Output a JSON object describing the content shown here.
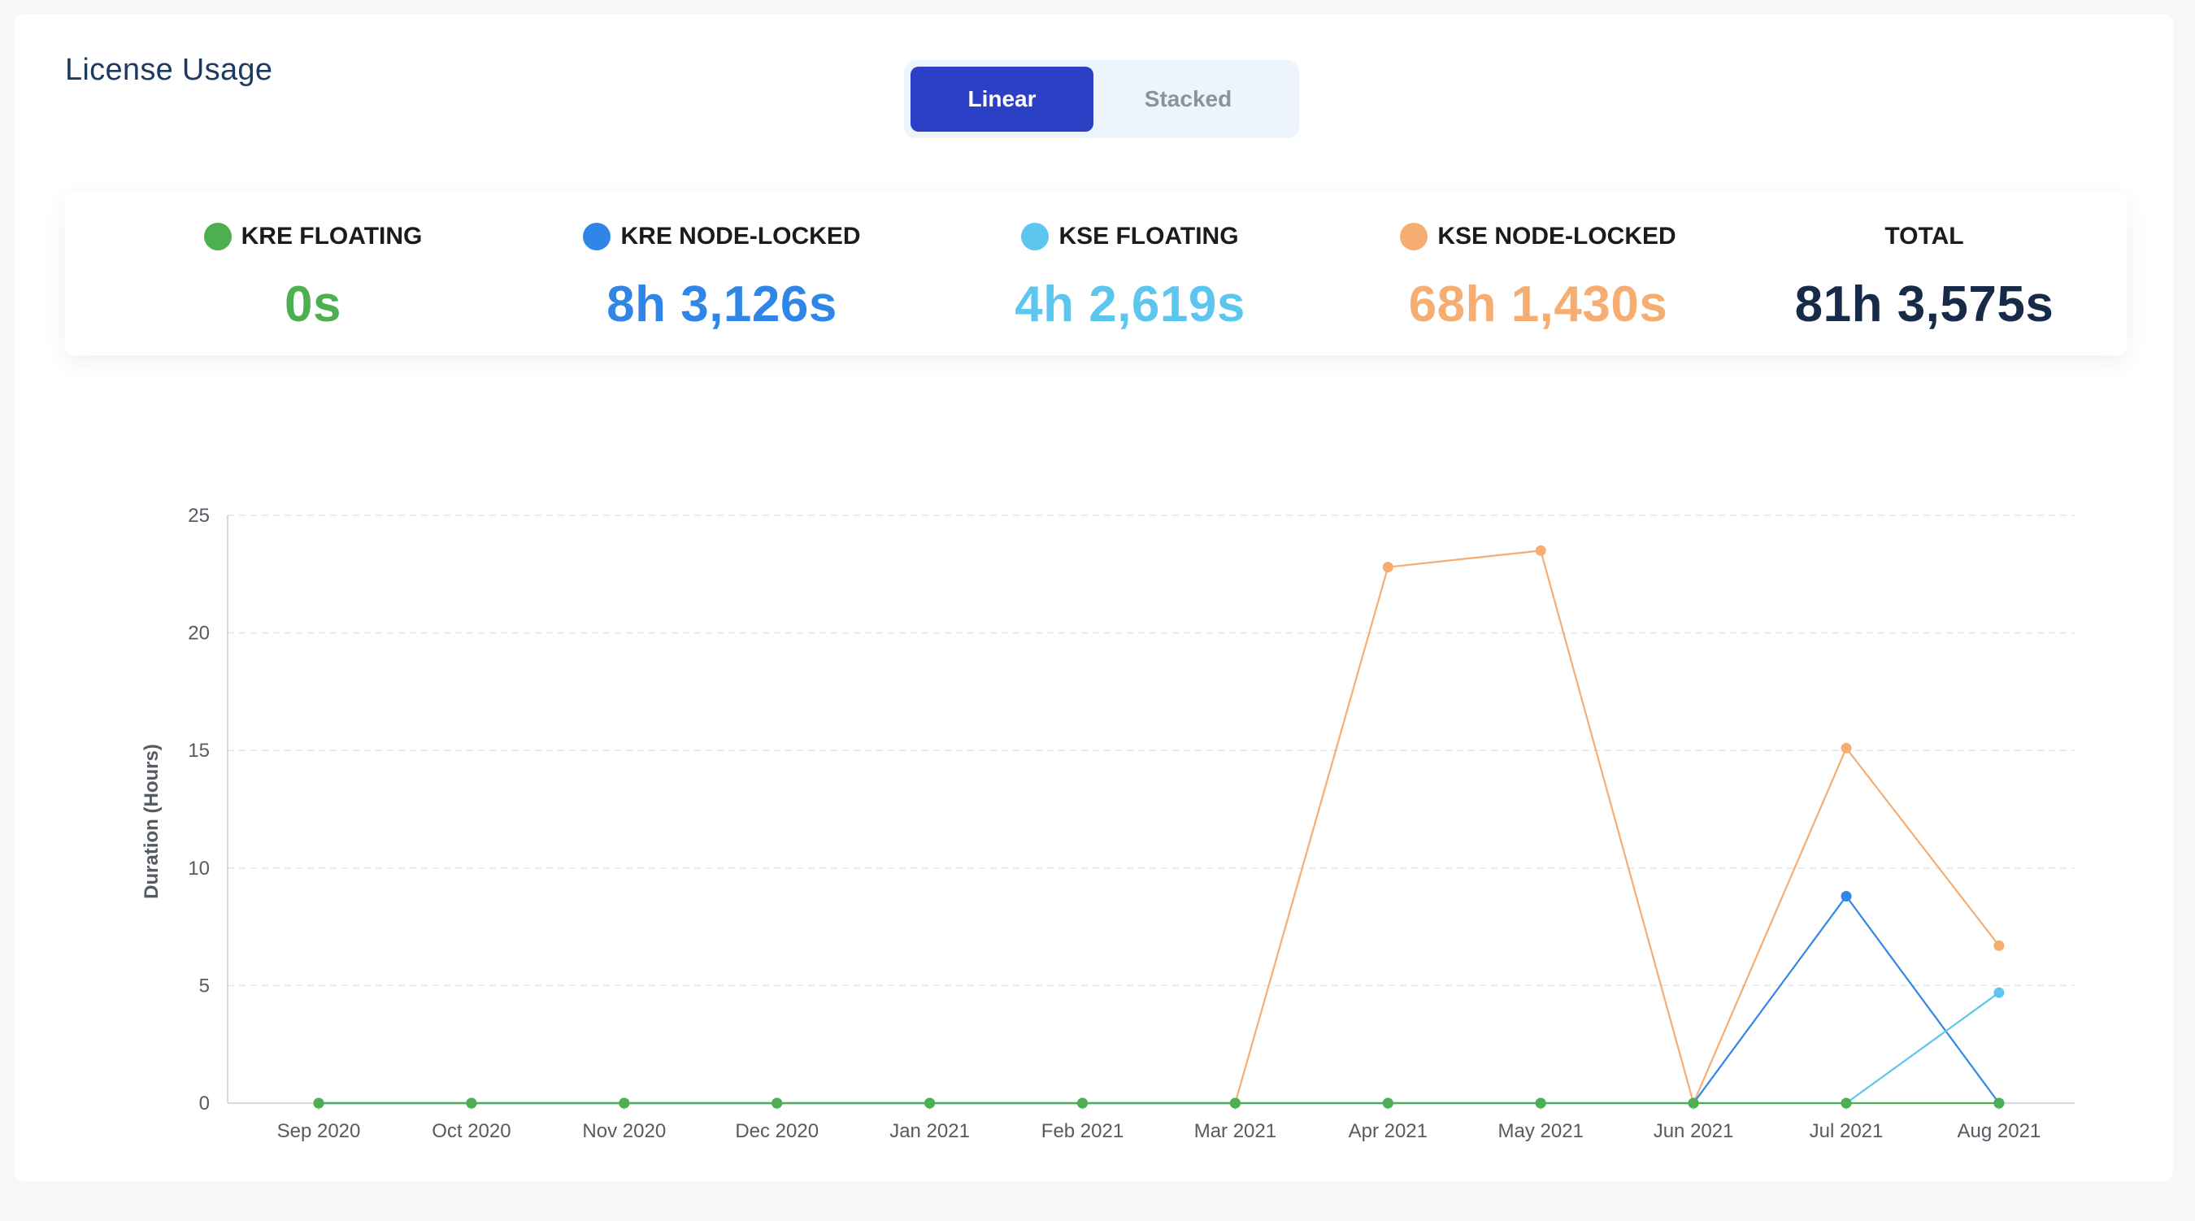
{
  "header": {
    "title": "License Usage"
  },
  "toggle": {
    "options": [
      "Linear",
      "Stacked"
    ],
    "selected": "Linear"
  },
  "summary": [
    {
      "label": "KRE FLOATING",
      "value": "0s",
      "color": "#4caf50"
    },
    {
      "label": "KRE NODE-LOCKED",
      "value": "8h 3,126s",
      "color": "#2f86e6"
    },
    {
      "label": "KSE FLOATING",
      "value": "4h 2,619s",
      "color": "#5cc6ee"
    },
    {
      "label": "KSE NODE-LOCKED",
      "value": "68h 1,430s",
      "color": "#f5ad72"
    },
    {
      "label": "TOTAL",
      "value": "81h 3,575s",
      "color": "#172a48"
    }
  ],
  "chart_data": {
    "type": "line",
    "title": "",
    "xlabel": "",
    "ylabel": "Duration (Hours)",
    "ylim": [
      0,
      25
    ],
    "yticks": [
      0,
      5,
      10,
      15,
      20,
      25
    ],
    "grid": true,
    "categories": [
      "Sep 2020",
      "Oct 2020",
      "Nov 2020",
      "Dec 2020",
      "Jan 2021",
      "Feb 2021",
      "Mar 2021",
      "Apr 2021",
      "May 2021",
      "Jun 2021",
      "Jul 2021",
      "Aug 2021"
    ],
    "series": [
      {
        "name": "KSE NODE-LOCKED",
        "color": "#f5ad72",
        "values": [
          0,
          0,
          0,
          0,
          0,
          0,
          0,
          22.8,
          23.5,
          0,
          15.1,
          6.7
        ]
      },
      {
        "name": "KRE NODE-LOCKED",
        "color": "#2f86e6",
        "values": [
          0,
          0,
          0,
          0,
          0,
          0,
          0,
          0,
          0,
          0,
          8.8,
          0
        ]
      },
      {
        "name": "KSE FLOATING",
        "color": "#5cc6ee",
        "values": [
          0,
          0,
          0,
          0,
          0,
          0,
          0,
          0,
          0,
          0,
          0,
          4.7
        ]
      },
      {
        "name": "KRE FLOATING",
        "color": "#4caf50",
        "values": [
          0,
          0,
          0,
          0,
          0,
          0,
          0,
          0,
          0,
          0,
          0,
          0
        ]
      }
    ]
  }
}
